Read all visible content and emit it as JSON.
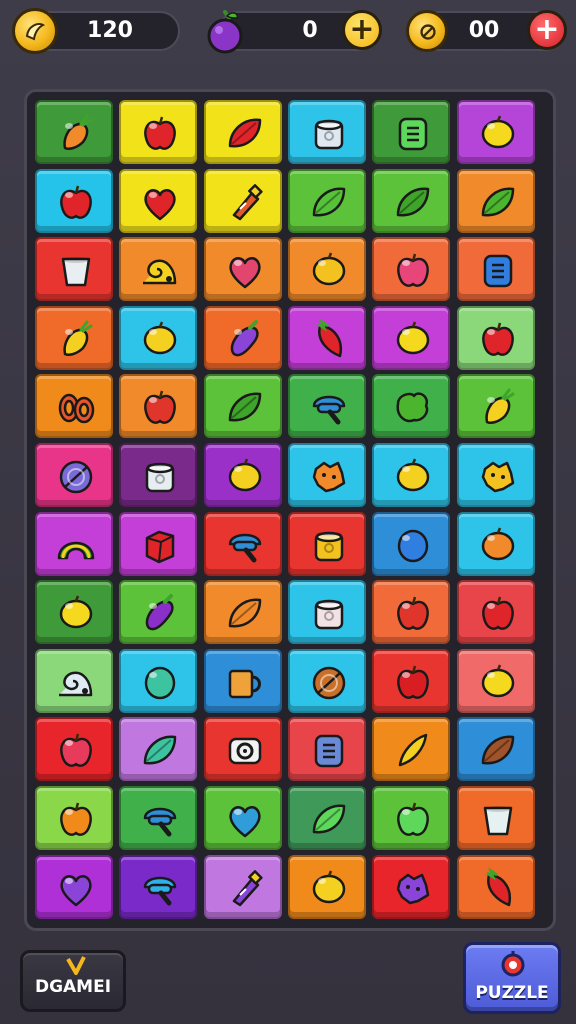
{
  "hud": {
    "coins": {
      "value": "120",
      "icon": "coin-icon"
    },
    "grapes": {
      "value": "0",
      "icon": "grape-icon",
      "add_icon": "plus-icon"
    },
    "gems": {
      "value": "00",
      "icon": "coin-icon",
      "add_icon": "plus-icon"
    }
  },
  "buttons": {
    "game": {
      "label": "DGAMEI",
      "icon": "v-icon"
    },
    "puzzle": {
      "label": "PUZZLE",
      "icon": "puzzle-icon"
    }
  },
  "board": {
    "rows": 12,
    "cols": 6,
    "tiles": [
      [
        {
          "bg": "#3f9a3a",
          "icon": "carrot-icon",
          "c": "#f08a2a"
        },
        {
          "bg": "#f2e21a",
          "icon": "apple-icon",
          "c": "#e0252a"
        },
        {
          "bg": "#f2e21a",
          "icon": "leaf-icon",
          "c": "#e0252a"
        },
        {
          "bg": "#2ec3e8",
          "icon": "cylinder-icon",
          "c": "#dfe8f0"
        },
        {
          "bg": "#3f9a3a",
          "icon": "box-icon",
          "c": "#5ed85a"
        },
        {
          "bg": "#b545d8",
          "icon": "lemon-icon",
          "c": "#f4d91e"
        }
      ],
      [
        {
          "bg": "#25c3ea",
          "icon": "apple-icon",
          "c": "#e0252a"
        },
        {
          "bg": "#f2e21a",
          "icon": "heart-icon",
          "c": "#e0252a"
        },
        {
          "bg": "#f2e21a",
          "icon": "bottle-icon",
          "c": "#e05a2a"
        },
        {
          "bg": "#5bc23a",
          "icon": "leaf-icon",
          "c": "#56c23a"
        },
        {
          "bg": "#5bc23a",
          "icon": "leaf-icon",
          "c": "#3ea42a"
        },
        {
          "bg": "#f08a2a",
          "icon": "leaf-icon",
          "c": "#4cb52e"
        }
      ],
      [
        {
          "bg": "#e8352f",
          "icon": "cup-icon",
          "c": "#e8eef2"
        },
        {
          "bg": "#f08a2a",
          "icon": "snail-icon",
          "c": "#f4d020"
        },
        {
          "bg": "#f08a2a",
          "icon": "heart-icon",
          "c": "#e2466e"
        },
        {
          "bg": "#f08a2a",
          "icon": "lemon-icon",
          "c": "#f4c21e"
        },
        {
          "bg": "#f06a3a",
          "icon": "apple-icon",
          "c": "#e8457a"
        },
        {
          "bg": "#f06a3a",
          "icon": "box-icon",
          "c": "#2f7ee0"
        }
      ],
      [
        {
          "bg": "#f06a2a",
          "icon": "carrot-icon",
          "c": "#f4d020"
        },
        {
          "bg": "#2ec3e8",
          "icon": "lemon-icon",
          "c": "#f4d020"
        },
        {
          "bg": "#f06a2a",
          "icon": "eggplant-icon",
          "c": "#8a45d8"
        },
        {
          "bg": "#c43ed8",
          "icon": "pepper-icon",
          "c": "#e0252a"
        },
        {
          "bg": "#c43ed8",
          "icon": "lemon-icon",
          "c": "#f4d91e"
        },
        {
          "bg": "#8ad87a",
          "icon": "apple-icon",
          "c": "#e0252a"
        }
      ],
      [
        {
          "bg": "#f08a1a",
          "icon": "rings-icon",
          "c": "#e8552a"
        },
        {
          "bg": "#f08a2a",
          "icon": "apple-icon",
          "c": "#e0352a"
        },
        {
          "bg": "#5bc23a",
          "icon": "leaf-icon",
          "c": "#3ea42a"
        },
        {
          "bg": "#3fb04a",
          "icon": "mushroom-icon",
          "c": "#2f8ed8"
        },
        {
          "bg": "#3fb04a",
          "icon": "broccoli-icon",
          "c": "#4cb52e"
        },
        {
          "bg": "#5bc23a",
          "icon": "carrot-icon",
          "c": "#f4d020"
        }
      ],
      [
        {
          "bg": "#e8358a",
          "icon": "disc-icon",
          "c": "#7a6ad8"
        },
        {
          "bg": "#7a2a8a",
          "icon": "cylinder-icon",
          "c": "#e6eef2"
        },
        {
          "bg": "#9a30c8",
          "icon": "lemon-icon",
          "c": "#f4d020"
        },
        {
          "bg": "#2ec3e8",
          "icon": "splat-icon",
          "c": "#f08a2a"
        },
        {
          "bg": "#2ec3e8",
          "icon": "lemon-icon",
          "c": "#f4d020"
        },
        {
          "bg": "#2ec3e8",
          "icon": "splat-icon",
          "c": "#f4c21e"
        }
      ],
      [
        {
          "bg": "#c43ed8",
          "icon": "rainbow-icon",
          "c": "#3ea42a"
        },
        {
          "bg": "#c43ed8",
          "icon": "cube-icon",
          "c": "#e0252a"
        },
        {
          "bg": "#e8352f",
          "icon": "mushroom-icon",
          "c": "#2f8ed8"
        },
        {
          "bg": "#e8352f",
          "icon": "cylinder-icon",
          "c": "#f4c21e"
        },
        {
          "bg": "#2f8ed8",
          "icon": "egg-icon",
          "c": "#2f7ee0"
        },
        {
          "bg": "#2ec3e8",
          "icon": "lemon-icon",
          "c": "#f08a2a"
        }
      ],
      [
        {
          "bg": "#3f9a3a",
          "icon": "lemon-icon",
          "c": "#f4d91e"
        },
        {
          "bg": "#5bc23a",
          "icon": "eggplant-icon",
          "c": "#8a30c8"
        },
        {
          "bg": "#f08a2a",
          "icon": "leaf-icon",
          "c": "#f08a2a"
        },
        {
          "bg": "#2ec3e8",
          "icon": "cylinder-icon",
          "c": "#f2e2e6"
        },
        {
          "bg": "#f06a3a",
          "icon": "apple-icon",
          "c": "#e0352a"
        },
        {
          "bg": "#e8454a",
          "icon": "apple-icon",
          "c": "#e0252a"
        }
      ],
      [
        {
          "bg": "#8ad87a",
          "icon": "snail-icon",
          "c": "#dfeaf2"
        },
        {
          "bg": "#2ec3e8",
          "icon": "egg-icon",
          "c": "#3ec3a0"
        },
        {
          "bg": "#2f8ed8",
          "icon": "mug-icon",
          "c": "#f0a23a"
        },
        {
          "bg": "#2ec3e8",
          "icon": "disc-icon",
          "c": "#c8702a"
        },
        {
          "bg": "#e8352f",
          "icon": "apple-icon",
          "c": "#d81e22"
        },
        {
          "bg": "#f06a6a",
          "icon": "lemon-icon",
          "c": "#f4d91e"
        }
      ],
      [
        {
          "bg": "#e8252a",
          "icon": "apple-icon",
          "c": "#e83a5a"
        },
        {
          "bg": "#c078e0",
          "icon": "leaf-icon",
          "c": "#3ec3a0"
        },
        {
          "bg": "#e8352f",
          "icon": "tape-icon",
          "c": "#f2f2f2"
        },
        {
          "bg": "#e8454a",
          "icon": "box-icon",
          "c": "#6a8ad8"
        },
        {
          "bg": "#f08a1a",
          "icon": "banana-icon",
          "c": "#f4d020"
        },
        {
          "bg": "#2f8ed8",
          "icon": "leaf-icon",
          "c": "#a0522a"
        }
      ],
      [
        {
          "bg": "#8ad84a",
          "icon": "apple-icon",
          "c": "#f08a1a"
        },
        {
          "bg": "#3fb04a",
          "icon": "mushroom-icon",
          "c": "#2f8ed8"
        },
        {
          "bg": "#5bc23a",
          "icon": "heart-icon",
          "c": "#2f9ed8"
        },
        {
          "bg": "#3f9a5a",
          "icon": "leaf-icon",
          "c": "#5ed85a"
        },
        {
          "bg": "#5bc23a",
          "icon": "apple-icon",
          "c": "#5ed85a"
        },
        {
          "bg": "#f06a2a",
          "icon": "cup-icon",
          "c": "#e6f2f2"
        }
      ],
      [
        {
          "bg": "#b030d8",
          "icon": "heart-icon",
          "c": "#8a45d8"
        },
        {
          "bg": "#7a2ac8",
          "icon": "mushroom-icon",
          "c": "#2fb0e8"
        },
        {
          "bg": "#c078e0",
          "icon": "bottle-icon",
          "c": "#8a45d8"
        },
        {
          "bg": "#f08a1a",
          "icon": "lemon-icon",
          "c": "#f4d020"
        },
        {
          "bg": "#e8252a",
          "icon": "splat-icon",
          "c": "#8a45d8"
        },
        {
          "bg": "#f06a2a",
          "icon": "pepper-icon",
          "c": "#e0252a"
        }
      ]
    ]
  }
}
